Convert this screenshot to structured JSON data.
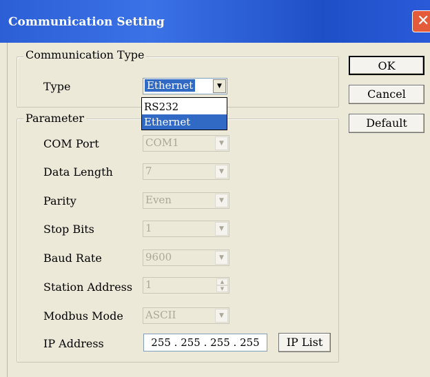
{
  "window": {
    "title": "Communication Setting",
    "close_symbol": "✕"
  },
  "buttons": {
    "ok": "OK",
    "cancel": "Cancel",
    "default": "Default",
    "ip_list": "IP List"
  },
  "comm_type": {
    "group_label": "Communication Type",
    "type_label": "Type",
    "type_value": "Ethernet",
    "options": [
      "RS232",
      "Ethernet"
    ],
    "selected_option": "Ethernet"
  },
  "parameter": {
    "group_label": "Parameter",
    "com_port": {
      "label": "COM Port",
      "value": "COM1"
    },
    "data_length": {
      "label": "Data Length",
      "value": "7"
    },
    "parity": {
      "label": "Parity",
      "value": "Even"
    },
    "stop_bits": {
      "label": "Stop Bits",
      "value": "1"
    },
    "baud_rate": {
      "label": "Baud Rate",
      "value": "9600"
    },
    "station_address": {
      "label": "Station Address",
      "value": "1"
    },
    "modbus_mode": {
      "label": "Modbus Mode",
      "value": "ASCII"
    },
    "ip_address": {
      "label": "IP Address",
      "value": "255 . 255 . 255 . 255"
    }
  },
  "icons": {
    "dropdown_arrow": "▼",
    "spin_up": "▲",
    "spin_down": "▼"
  }
}
